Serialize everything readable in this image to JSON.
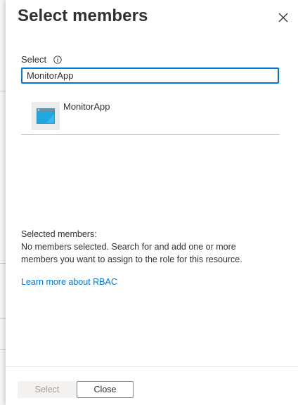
{
  "panel": {
    "title": "Select members",
    "close_icon": "close-icon"
  },
  "search": {
    "label": "Select",
    "info_icon": "info-icon",
    "value": "MonitorApp"
  },
  "results": [
    {
      "name": "MonitorApp",
      "icon": "app-registration-icon"
    }
  ],
  "selected": {
    "heading": "Selected members:",
    "line1": "No members selected. Search for and add one or more",
    "line2": "members you want to assign to the role for this resource."
  },
  "links": {
    "learn_more": "Learn more about RBAC"
  },
  "footer": {
    "select_label": "Select",
    "close_label": "Close"
  },
  "colors": {
    "accent": "#0078d4",
    "app_icon_blue": "#1fa7e0",
    "disabled_text": "#a19f9d"
  }
}
